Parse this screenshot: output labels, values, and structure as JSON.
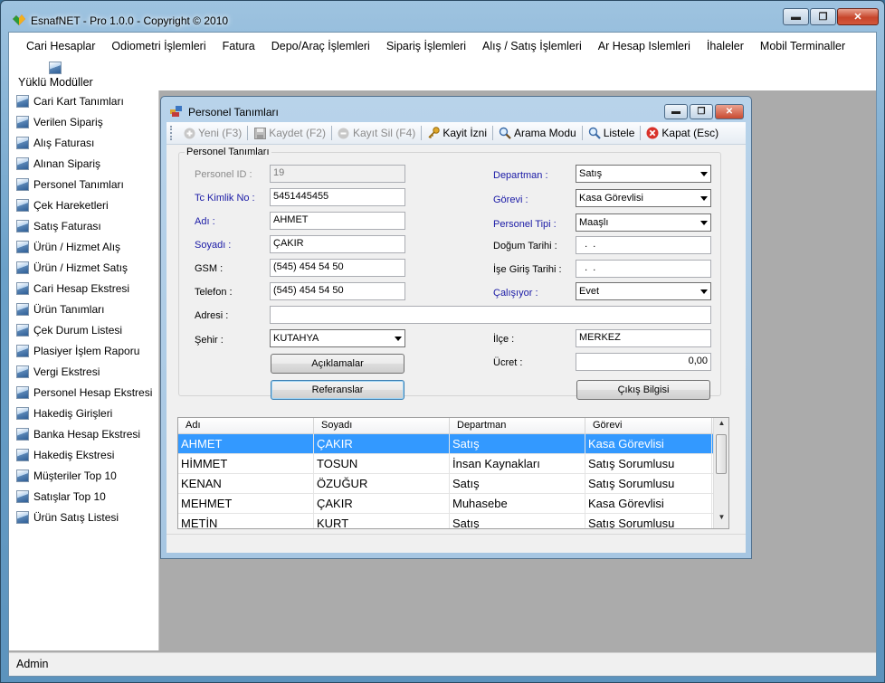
{
  "app": {
    "title": "EsnafNET - Pro 1.0.0 - Copyright ©  2010",
    "minimize": "▬",
    "maximize": "❐",
    "close": "✕"
  },
  "menu": [
    "Cari Hesaplar",
    "Odiometri İşlemleri",
    "Fatura",
    "Depo/Araç İşlemleri",
    "Sipariş İşlemleri",
    "Alış / Satış İşlemleri",
    "Ar Hesap Islemleri",
    "İhaleler",
    "Mobil Terminaller"
  ],
  "modules_label": "Yüklü Modüller",
  "sidebar": [
    "Cari Kart Tanımları",
    "Verilen Sipariş",
    "Alış Faturası",
    "Alınan Sipariş",
    "Personel Tanımları",
    "Çek Hareketleri",
    "Satış Faturası",
    "Ürün / Hizmet Alış",
    "Ürün / Hizmet Satış",
    "Cari Hesap Ekstresi",
    "Ürün Tanımları",
    "Çek Durum Listesi",
    "Plasiyer İşlem Raporu",
    "Vergi Ekstresi",
    "Personel Hesap Ekstresi",
    "Hakediş Girişleri",
    "Banka Hesap Ekstresi",
    "Hakediş Ekstresi",
    "Müşteriler Top 10",
    "Satışlar Top 10",
    "Ürün Satış Listesi"
  ],
  "status": "Admin",
  "child": {
    "title": "Personel Tanımları",
    "minimize": "▬",
    "maximize": "❐",
    "close": "✕",
    "toolbar": {
      "new": "Yeni (F3)",
      "save": "Kaydet (F2)",
      "delete": "Kayıt Sil (F4)",
      "permission": "Kayit İzni",
      "search": "Arama Modu",
      "list": "Listele",
      "close": "Kapat (Esc)"
    },
    "group_title": "Personel Tanımları",
    "labels": {
      "personel_id": "Personel ID :",
      "tc": "Tc Kimlik No :",
      "adi": "Adı :",
      "soyadi": "Soyadı :",
      "gsm": "GSM :",
      "telefon": "Telefon :",
      "adresi": "Adresi :",
      "sehir": "Şehir :",
      "departman": "Departman :",
      "gorevi": "Görevi :",
      "personel_tipi": "Personel Tipi :",
      "dogum": "Doğum Tarihi :",
      "ise_giris": "İşe Giriş Tarihi :",
      "calisiyor": "Çalışıyor :",
      "ilce": "İlçe :",
      "ucret": "Ücret :"
    },
    "values": {
      "personel_id": "19",
      "tc": "5451445455",
      "adi": "AHMET",
      "soyadi": "ÇAKIR",
      "gsm": "(545) 454 54 50",
      "telefon": "(545) 454 54 50",
      "adresi": "",
      "sehir": "KUTAHYA",
      "departman": "Satış",
      "gorevi": "Kasa Görevlisi",
      "personel_tipi": "Maaşlı",
      "dogum": "  .  .",
      "ise_giris": "  .  .",
      "calisiyor": "Evet",
      "ilce": "MERKEZ",
      "ucret": "0,00"
    },
    "buttons": {
      "aciklamalar": "Açıklamalar",
      "referanslar": "Referanslar",
      "cikis": "Çıkış Bilgisi"
    },
    "grid": {
      "columns": [
        "Adı",
        "Soyadı",
        "Departman",
        "Görevi"
      ],
      "rows": [
        [
          "AHMET",
          "ÇAKIR",
          "Satış",
          "Kasa Görevlisi"
        ],
        [
          "HİMMET",
          "TOSUN",
          "İnsan Kaynakları",
          "Satış Sorumlusu"
        ],
        [
          "KENAN",
          "ÖZUĞUR",
          "Satış",
          "Satış Sorumlusu"
        ],
        [
          "MEHMET",
          "ÇAKIR",
          "Muhasebe",
          "Kasa Görevlisi"
        ],
        [
          "METİN",
          "KURT",
          "Satış",
          "Satış Sorumlusu"
        ]
      ],
      "scroll_up": "▲",
      "scroll_down": "▼"
    }
  }
}
